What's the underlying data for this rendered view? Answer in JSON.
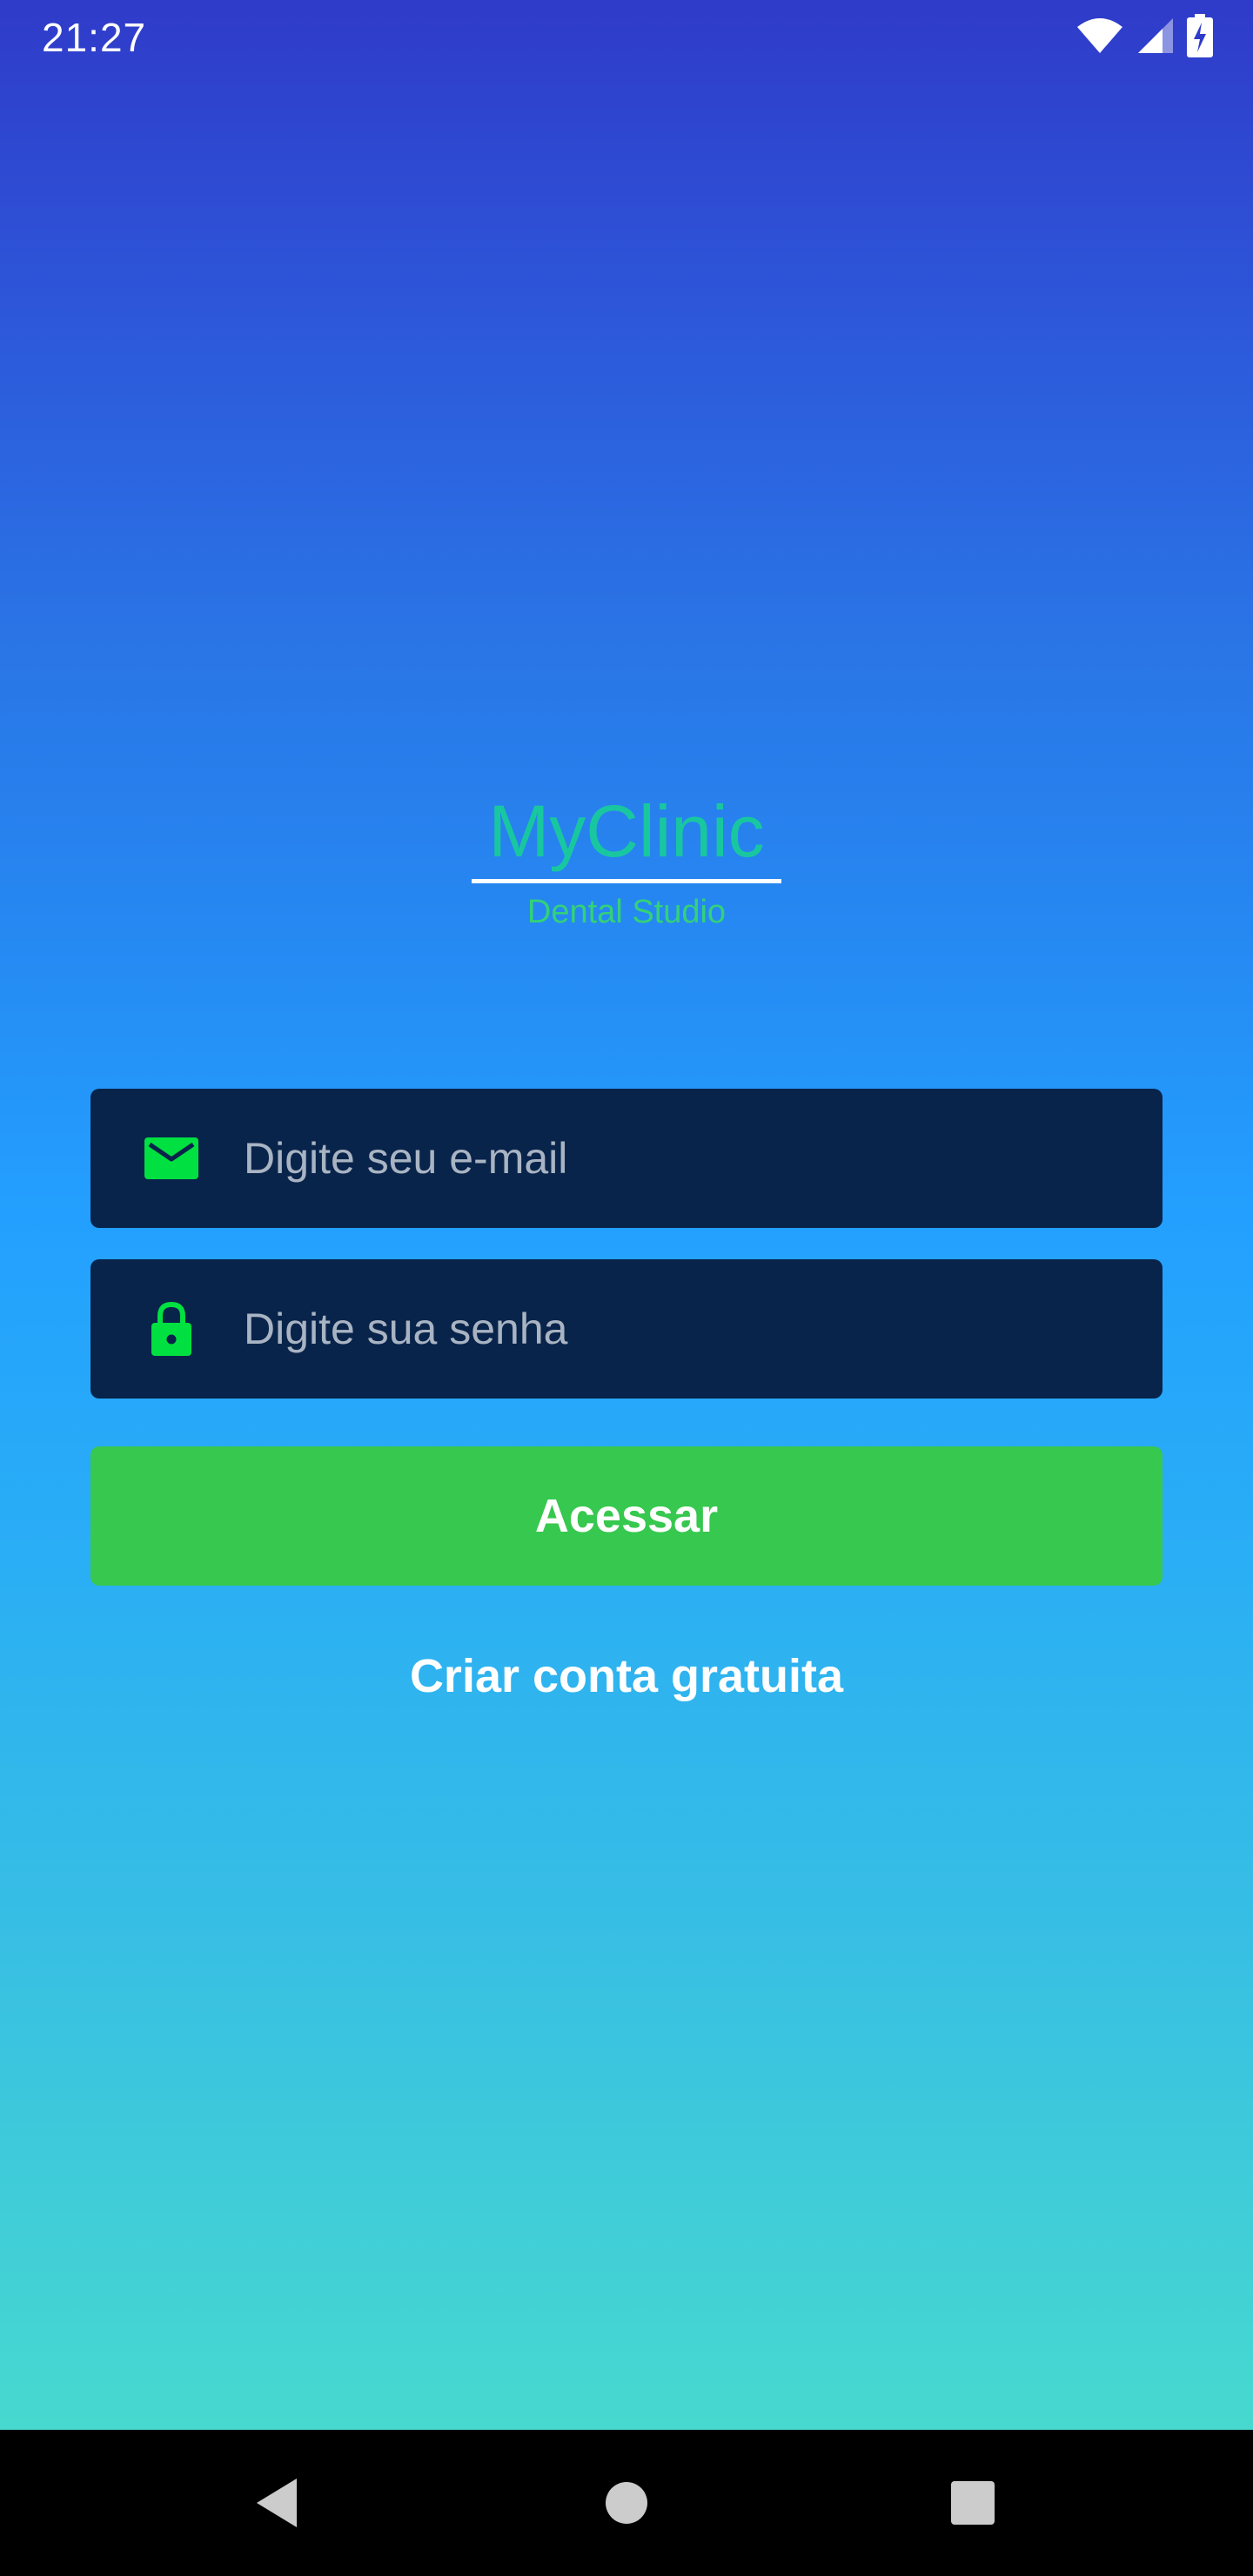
{
  "status_bar": {
    "time": "21:27",
    "icons": [
      "wifi-icon",
      "signal-icon",
      "battery-charging-icon"
    ]
  },
  "logo": {
    "title": "MyClinic",
    "subtitle": "Dental Studio",
    "title_color": "#18c7a0",
    "subtitle_color": "#33d17a"
  },
  "form": {
    "email": {
      "placeholder": "Digite seu e-mail",
      "value": "",
      "icon": "mail-icon"
    },
    "password": {
      "placeholder": "Digite sua senha",
      "value": "",
      "icon": "lock-icon"
    },
    "login_label": "Acessar",
    "signup_label": "Criar conta gratuita"
  },
  "nav_bar": {
    "buttons": [
      "back-icon",
      "home-icon",
      "recents-icon"
    ]
  },
  "colors": {
    "gradient_top": "#2f3bc9",
    "gradient_mid": "#23a0ff",
    "gradient_bottom": "#47d9cf",
    "field_background": "#09244b",
    "icon_accent": "#00e040",
    "button_green": "#37c84f"
  }
}
